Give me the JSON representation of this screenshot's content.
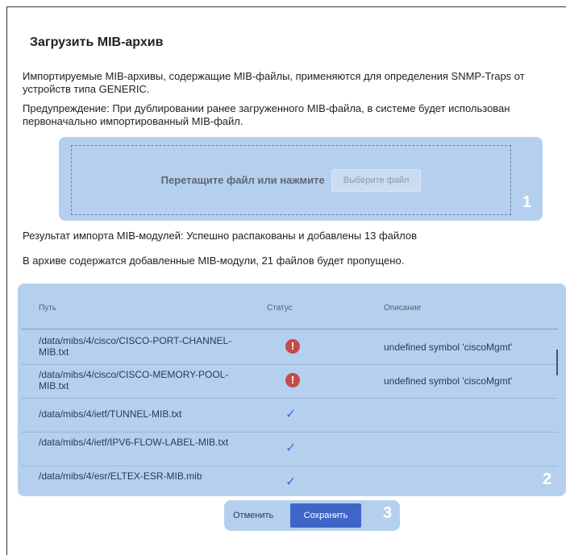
{
  "title": "Загрузить MIB-архив",
  "description": "Импортируемые MIB-архивы, содержащие MIB-файлы, применяются для определения SNMP-Traps от устройств типа GENERIC.",
  "warning": "Предупреждение: При дублировании ранее загруженного MIB-файла, в системе будет использован первоначально импортированный MIB-файл.",
  "upload": {
    "drop_text": "Перетащите файл или нажмите",
    "pick_button": "Выберите файл",
    "badge": "1"
  },
  "result_line": "Результат импорта MIB-модулей: Успешно распакованы и добавлены 13 файлов",
  "skipped_line": "В архиве содержатся добавленные MIB-модули, 21 файлов будет пропущено.",
  "table": {
    "badge": "2",
    "headers": {
      "path": "Путь",
      "status": "Статус",
      "description": "Описание"
    },
    "rows": [
      {
        "path": "/data/mibs/4/cisco/CISCO-PORT-CHANNEL-MIB.txt",
        "status": "error",
        "description": "undefined symbol 'ciscoMgmt'"
      },
      {
        "path": "/data/mibs/4/cisco/CISCO-MEMORY-POOL-MIB.txt",
        "status": "error",
        "description": "undefined symbol 'ciscoMgmt'"
      },
      {
        "path": "/data/mibs/4/ietf/TUNNEL-MIB.txt",
        "status": "ok",
        "description": ""
      },
      {
        "path": "/data/mibs/4/ietf/IPV6-FLOW-LABEL-MIB.txt",
        "status": "ok",
        "description": ""
      },
      {
        "path": "/data/mibs/4/esr/ELTEX-ESR-MIB.mib",
        "status": "ok",
        "description": ""
      }
    ]
  },
  "actions": {
    "cancel": "Отменить",
    "save": "Сохранить",
    "badge": "3"
  },
  "colors": {
    "highlight": "#b5d0ef",
    "primary": "#3f66c6",
    "error": "#c64a4a",
    "check": "#3d6fc8"
  }
}
